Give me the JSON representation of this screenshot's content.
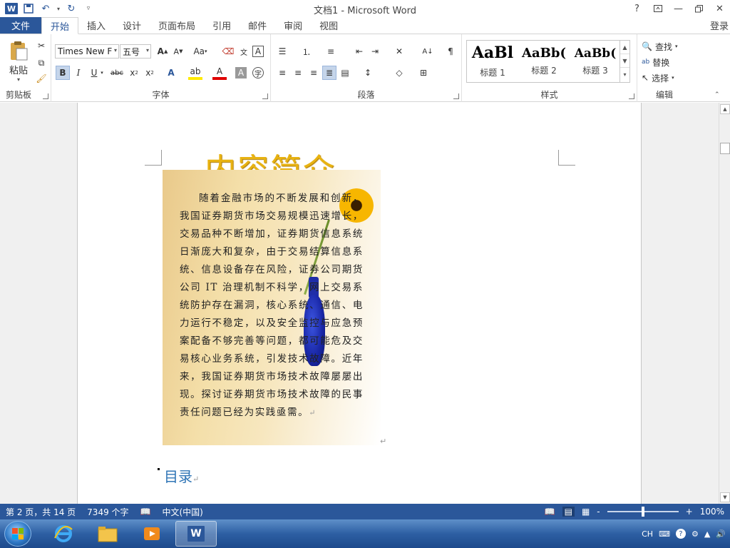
{
  "app": {
    "window_title": "文档1 - Microsoft Word",
    "login": "登录",
    "help": "?"
  },
  "tabs": [
    {
      "label": "文件"
    },
    {
      "label": "开始"
    },
    {
      "label": "插入"
    },
    {
      "label": "设计"
    },
    {
      "label": "页面布局"
    },
    {
      "label": "引用"
    },
    {
      "label": "邮件"
    },
    {
      "label": "审阅"
    },
    {
      "label": "视图"
    }
  ],
  "ribbon": {
    "clipboard": {
      "paste": "粘贴",
      "group": "剪贴板"
    },
    "font": {
      "name": "Times New F",
      "size": "五号",
      "group": "字体",
      "change_case": "Aa"
    },
    "paragraph": {
      "group": "段落"
    },
    "styles": {
      "group": "样式",
      "items": [
        {
          "sample": "AaBl",
          "name": "标题 1"
        },
        {
          "sample": "AaBb(",
          "name": "标题 2"
        },
        {
          "sample": "AaBb(",
          "name": "标题 3"
        }
      ]
    },
    "editing": {
      "find": "查找",
      "replace": "替换",
      "select": "选择",
      "group": "编辑"
    }
  },
  "document": {
    "title": "内容简介",
    "body": "随着金融市场的不断发展和创新，我国证券期货市场交易规模迅速增长，交易品种不断增加，证券期货信息系统日渐庞大和复杂，由于交易结算信息系统、信息设备存在风险，证券公司期货公司 IT 治理机制不科学，网上交易系统防护存在漏洞，核心系统、通信、电力运行不稳定，以及安全监控与应急预案配备不够完善等问题，都可能危及交易核心业务系统，引发技术故障。近年来，我国证券期货市场技术故障屡屡出现。探讨证券期货市场技术故障的民事责任问题已经为实践亟需。",
    "toc": "目录",
    "para_mark": "↵"
  },
  "status": {
    "page": "第 2 页，共 14 页",
    "words": "7349 个字",
    "language": "中文(中国)",
    "zoom": "100%",
    "zoom_minus": "-",
    "zoom_plus": "+"
  },
  "taskbar": {
    "input_lang": "CH"
  },
  "colors": {
    "word_blue": "#2b579a",
    "title_gold": "#e8b312",
    "toc_blue": "#2e74b5"
  }
}
